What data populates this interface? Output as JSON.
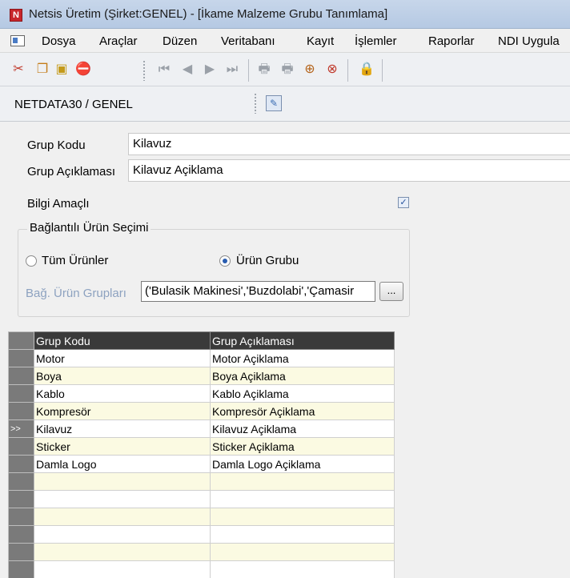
{
  "window": {
    "title": "Netsis Üretim (Şirket:GENEL) - [İkame Malzeme Grubu Tanımlama]",
    "app_icon_letter": "N"
  },
  "menu": [
    "Dosya",
    "Araçlar",
    "Düzen",
    "Veritabanı",
    "Kayıt",
    "İşlemler",
    "Raporlar",
    "NDI Uygula"
  ],
  "dbbar": {
    "label": "NETDATA30 / GENEL"
  },
  "form": {
    "grup_kodu_label": "Grup Kodu",
    "grup_kodu_value": "Kilavuz",
    "grup_aciklamasi_label": "Grup Açıklaması",
    "grup_aciklamasi_value": "Kilavuz Açiklama",
    "bilgi_amacli_label": "Bilgi Amaçlı",
    "bilgi_amacli_checked": true,
    "groupbox_title": "Bağlantılı Ürün Seçimi",
    "radio_all_label": "Tüm Ürünler",
    "radio_group_label": "Ürün Grubu",
    "selected_radio": "Ürün Grubu",
    "bag_urun_label": "Bağ. Ürün Grupları",
    "bag_urun_value": "('Bulasik Makinesi','Buzdolabi','Çamasir",
    "ellipsis_label": "..."
  },
  "grid": {
    "columns": [
      "Grup Kodu",
      "Grup Açıklaması"
    ],
    "current_row_marker": ">>",
    "rows": [
      [
        "Motor",
        "Motor Açiklama"
      ],
      [
        "Boya",
        "Boya Açiklama"
      ],
      [
        "Kablo",
        "Kablo Açiklama"
      ],
      [
        "Kompresör",
        "Kompresör Açiklama"
      ],
      [
        "Kilavuz",
        "Kilavuz Açiklama"
      ],
      [
        "Sticker",
        "Sticker Açiklama"
      ],
      [
        "Damla Logo",
        "Damla Logo Açiklama"
      ],
      [
        "",
        ""
      ],
      [
        "",
        ""
      ],
      [
        "",
        ""
      ],
      [
        "",
        ""
      ],
      [
        "",
        ""
      ],
      [
        "",
        ""
      ],
      [
        "",
        ""
      ]
    ],
    "current_row_index": 4
  }
}
